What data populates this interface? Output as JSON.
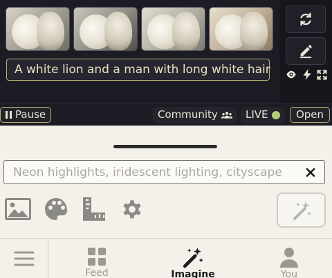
{
  "live_feed": {
    "prompt_text": "A white lion and a man with long white hair",
    "thumbnails": [
      "lion-image-1",
      "lion-image-2",
      "lion-image-3",
      "lion-image-4"
    ]
  },
  "controls": {
    "pause_label": "Pause",
    "community_label": "Community",
    "live_label": "LIVE",
    "open_label": "Open"
  },
  "composer": {
    "placeholder": "Neon highlights, iridescent lighting, cityscape"
  },
  "tabs": {
    "feed_label": "Feed",
    "imagine_label": "Imagine",
    "you_label": "You"
  },
  "colors": {
    "accent_border": "#b9b172",
    "live_dot": "#b4cf7a",
    "dark_bg": "#1d1c25",
    "sheet_bg": "#f3f1ea"
  }
}
